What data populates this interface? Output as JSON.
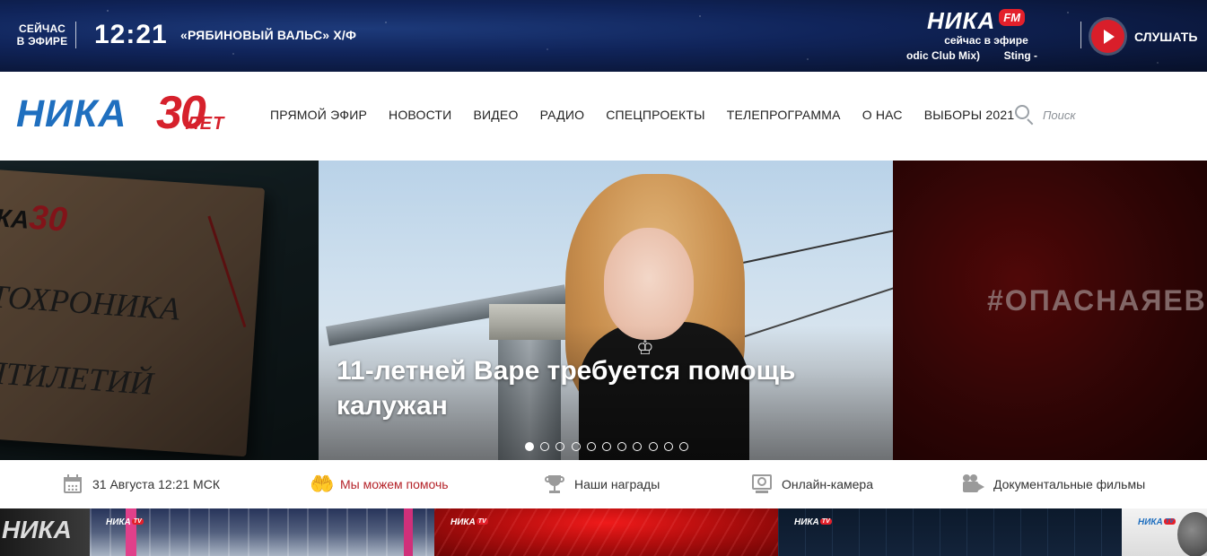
{
  "topbar": {
    "on_air_label": "СЕЙЧАС В ЭФИРЕ",
    "time": "12:21",
    "program": "«РЯБИНОВЫЙ ВАЛЬС» Х/Ф",
    "radio": {
      "brand": "НИКА",
      "brand_badge": "FM",
      "now_label": "сейчас в эфире",
      "track_visible": "odic Club Mix)        Sting -"
    },
    "listen_label": "СЛУШАТЬ"
  },
  "header": {
    "logo": {
      "brand": "НИКА",
      "years": "30",
      "years_suffix": "ЛЕТ"
    },
    "nav": [
      "ПРЯМОЙ ЭФИР",
      "НОВОСТИ",
      "ВИДЕО",
      "РАДИО",
      "СПЕЦПРОЕКТЫ",
      "ТЕЛЕПРОГРАММА",
      "О НАС",
      "ВЫБОРЫ 2021"
    ],
    "search": {
      "placeholder": "Поиск"
    }
  },
  "slider": {
    "left_slide": {
      "logo": "КА",
      "logo_num": "30",
      "text_1": "ТОХРОНИКА",
      "text_2": "ЯТИЛЕТИЙ"
    },
    "main_slide": {
      "title": "11-летней Варе требуется помощь калужан"
    },
    "right_slide": {
      "hashtag": "#ОПАСНАЯЕВ"
    },
    "dots_count": 11,
    "active_dot": 0
  },
  "info_strip": {
    "date": "31 Августа 12:21 МСК",
    "help": "Мы можем помочь",
    "awards": "Наши награды",
    "camera": "Онлайн-камера",
    "films": "Документальные фильмы",
    "accent_color": "#b5242a"
  },
  "thumbs": {
    "logo": "НИКА",
    "logo_badge": "TV",
    "side_text": "НИКА"
  },
  "colors": {
    "brand_blue": "#1f6fbf",
    "brand_red": "#d6212c",
    "topbar_bg": "#10245a"
  },
  "icons": [
    "play-icon",
    "search-icon",
    "calendar-icon",
    "helping-hand-icon",
    "trophy-icon",
    "webcam-icon",
    "film-camera-icon"
  ]
}
